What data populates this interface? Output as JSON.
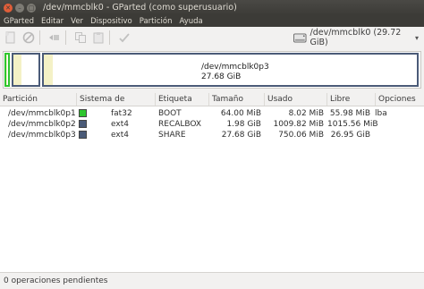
{
  "window": {
    "title": "/dev/mmcblk0 - GParted (como superusuario)"
  },
  "menu": [
    "GParted",
    "Editar",
    "Ver",
    "Dispositivo",
    "Partición",
    "Ayuda"
  ],
  "toolbar": {
    "buttons": [
      "new-icon",
      "delete-icon",
      "resize-icon",
      "copy-icon",
      "paste-icon",
      "apply-icon"
    ],
    "device_label": "/dev/mmcblk0  (29.72 GiB)"
  },
  "disk_map": {
    "selected_name": "/dev/mmcblk0p3",
    "selected_size": "27.68 GiB"
  },
  "table": {
    "headers": [
      "Partición",
      "Sistema de archivos",
      "Etiqueta",
      "Tamaño",
      "Usado",
      "Libre",
      "Opciones"
    ],
    "rows": [
      {
        "partition": "/dev/mmcblk0p1",
        "fs": "fat32",
        "fs_color": "#2ec52e",
        "label": "BOOT",
        "size": "64.00 MiB",
        "used": "8.02 MiB",
        "free": "55.98 MiB",
        "flags": "lba"
      },
      {
        "partition": "/dev/mmcblk0p2",
        "fs": "ext4",
        "fs_color": "#4b5b78",
        "label": "RECALBOX",
        "size": "1.98 GiB",
        "used": "1009.82 MiB",
        "free": "1015.56 MiB",
        "flags": ""
      },
      {
        "partition": "/dev/mmcblk0p3",
        "fs": "ext4",
        "fs_color": "#4b5b78",
        "label": "SHARE",
        "size": "27.68 GiB",
        "used": "750.06 MiB",
        "free": "26.95 GiB",
        "flags": ""
      }
    ]
  },
  "status": {
    "text": "0 operaciones pendientes"
  }
}
